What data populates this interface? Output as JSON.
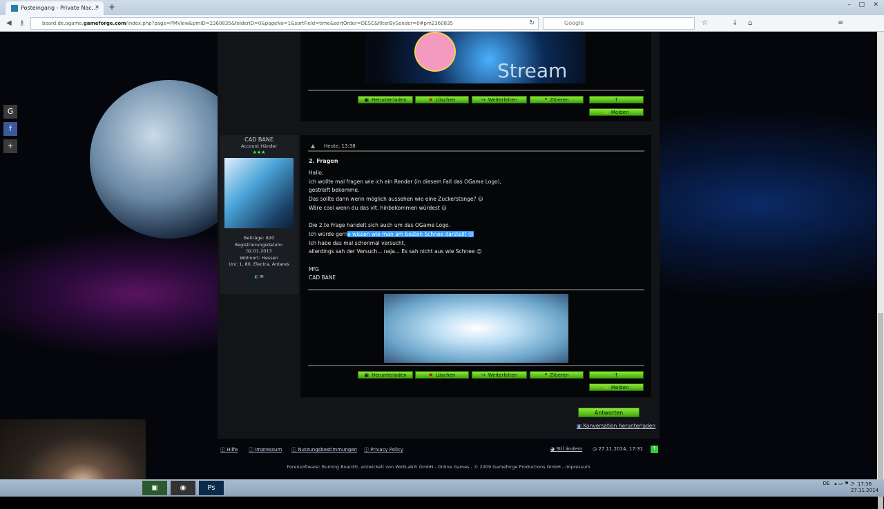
{
  "browser": {
    "tab_title": "Posteingang - Private Nac...",
    "url_prefix": "board.de.ogame.",
    "url_domain": "gameforge.com",
    "url_rest": "/index.php?page=PMView&pmID=2360835&folderID=0&pageNo=1&sortField=time&sortOrder=DESC&filterBySender=0#pm2360835",
    "search_placeholder": "Google"
  },
  "banner": {
    "text": "Stream"
  },
  "buttons": {
    "download": "Herunterladen",
    "delete": "Löschen",
    "forward": "Weiterleiten",
    "quote": "Zitieren",
    "top": "↑",
    "report": "Melden"
  },
  "author": {
    "name": "CAD BANE",
    "rank": "Account Händer",
    "stars": "★★★",
    "posts": "Beiträge: 820",
    "reg_label": "Registrierungsdatum:",
    "reg_date": "02.01.2013",
    "location": "Wohnort: Hessen",
    "universes": "Uni: 1, 80, Electra, Antares"
  },
  "post": {
    "time": "Heute, 13:38",
    "title": "2. Fragen",
    "lines": [
      "Hallo,",
      "ich wollte mal fragen wie ich ein Render (in diesem Fall das OGame Logo),",
      "gestreift bekomme.",
      "Das sollte dann wenn möglich aussehen wie eine Zuckerstange? ☺",
      "Wäre cool wenn du das vlt. hinbekommen würdest ☺",
      "",
      "Die 2.te Frage handelt sich auch um das OGame Logo."
    ],
    "line_sel_pre": "Ich würde gern",
    "line_sel": "e wissen wie man am besten Schnee darstellt ☺",
    "lines2": [
      "Ich habe das mal schonmal versucht,",
      "allerdings sah der Versuch... naja... Es sah nicht aus wie Schnee ☺",
      "",
      "MfG",
      "CAD BANE"
    ]
  },
  "actions": {
    "reply": "Antworten",
    "download_conversation": "Konversation herunterladen"
  },
  "footer": {
    "help": "Hilfe",
    "imprint": "Impressum",
    "terms": "Nutzungsbestimmungen",
    "privacy": "Privacy Policy",
    "style": "Stil ändern",
    "datetime": "27.11.2014, 17:31",
    "copyright": "Forensoftware: Burning Board®, entwickelt von WoltLab® GmbH - Online Games - © 2009 Gameforge Productions GmbH - Impressum"
  },
  "taskbar": {
    "lang": "DE",
    "time": "17:36",
    "date": "27.11.2014"
  },
  "colors": {
    "button_green": "#5cc41f",
    "selection": "#3399ff"
  }
}
